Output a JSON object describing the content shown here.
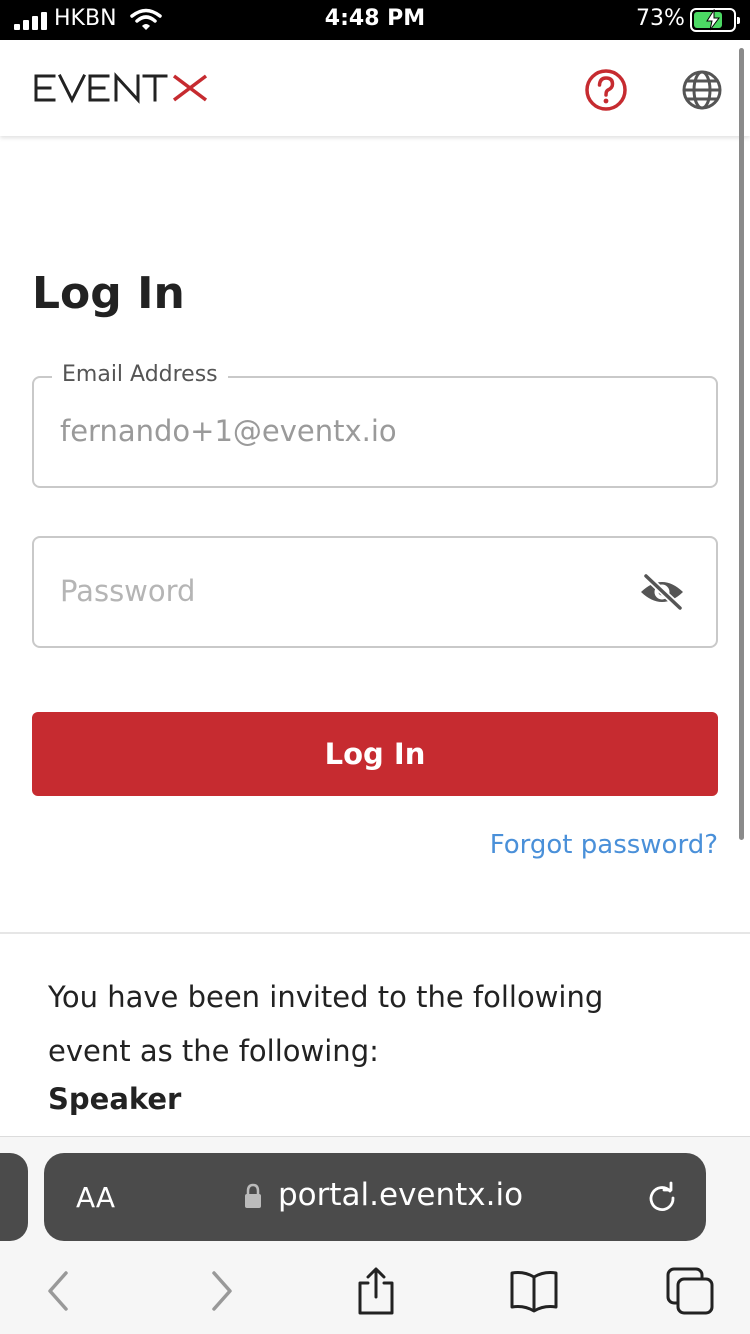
{
  "status_bar": {
    "carrier": "HKBN",
    "time": "4:48 PM",
    "battery": "73%"
  },
  "header": {
    "logo_text": "EVENTX",
    "brand_color": "#c62b30",
    "icons": [
      "help-icon",
      "globe-icon"
    ]
  },
  "login": {
    "title": "Log In",
    "email": {
      "label": "Email Address",
      "value": "fernando+1@eventx.io"
    },
    "password": {
      "placeholder": "Password",
      "value": ""
    },
    "submit_label": "Log In",
    "forgot_label": "Forgot password?"
  },
  "invite": {
    "message": "You have been invited to the following event as the following:",
    "role": "Speaker"
  },
  "browser": {
    "text_size_label": "AA",
    "url": "portal.eventx.io",
    "toolbar_icons": [
      "back-icon",
      "forward-icon",
      "share-icon",
      "bookmarks-icon",
      "tabs-icon"
    ]
  }
}
